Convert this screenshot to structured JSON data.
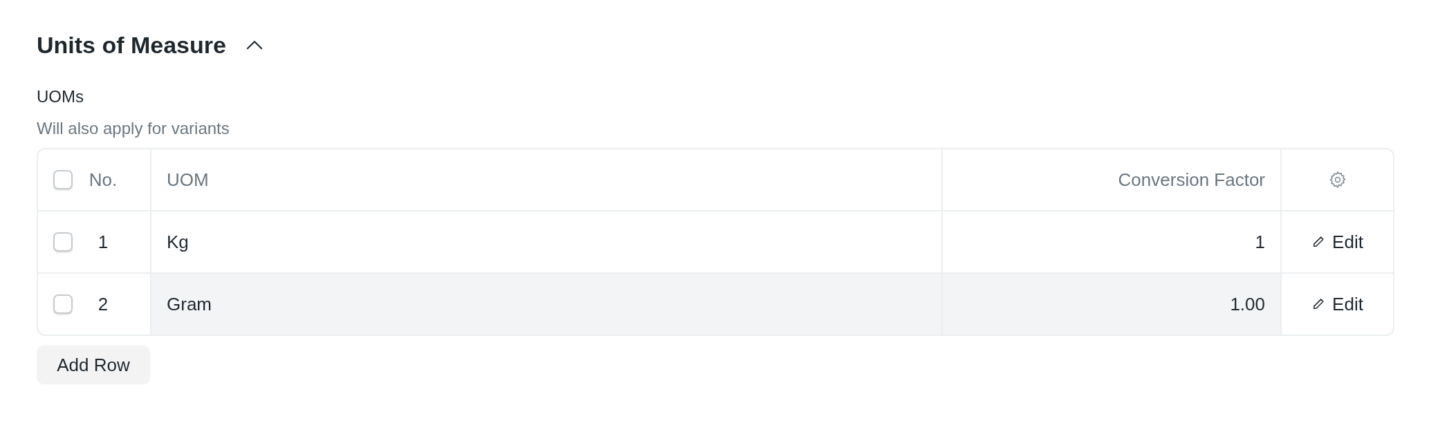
{
  "section": {
    "title": "Units of Measure",
    "expanded": true
  },
  "field": {
    "label": "UOMs",
    "description": "Will also apply for variants"
  },
  "table": {
    "header": {
      "checked": false,
      "columns": [
        "No.",
        "UOM",
        "Conversion Factor"
      ]
    },
    "rows": [
      {
        "checked": false,
        "no": "1",
        "uom": "Kg",
        "conversion_factor": "1",
        "highlighted": false,
        "action": "Edit"
      },
      {
        "checked": false,
        "no": "2",
        "uom": "Gram",
        "conversion_factor": "1.00",
        "highlighted": true,
        "action": "Edit"
      }
    ]
  },
  "add_button": "Add Row"
}
